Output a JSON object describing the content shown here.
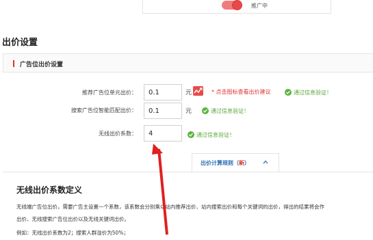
{
  "top_card": {
    "status_text": "推广中"
  },
  "section": {
    "title": "出价设置",
    "sub_title": "广告位出价设置"
  },
  "form": {
    "rows": [
      {
        "label": "推荐广告位单元出价：",
        "value": "0.1",
        "unit": "元",
        "red_hint": "* 点击图标查看出价建议",
        "green_hint": "通过信息验证！"
      },
      {
        "label": "搜索广告位智能匹配出价：",
        "value": "0.1",
        "unit": "元",
        "green_hint": "通过信息验证！"
      },
      {
        "label": "无线出价系数：",
        "value": "4",
        "green_hint": "通过信息验证！"
      }
    ]
  },
  "tab": {
    "label": "出价计算规则（",
    "new_label": "新",
    "label_end": "）"
  },
  "definition": {
    "title": "无线出价系数定义",
    "line1": "无线端广告位出价，需要广告主设置一个系数，该系数会分别乘以站内推荐出价、站内搜索出价和每个关键词的出价，得出的结果将会作",
    "line2": "出价、无线搜索广告位出价以及无线关键词出价。",
    "line3": "例如：无线出价系数为2；搜索人群溢价为50%；"
  },
  "colors": {
    "accent_red": "#e84848",
    "success_green": "#5bb33f",
    "link_blue": "#2f6fb3"
  }
}
